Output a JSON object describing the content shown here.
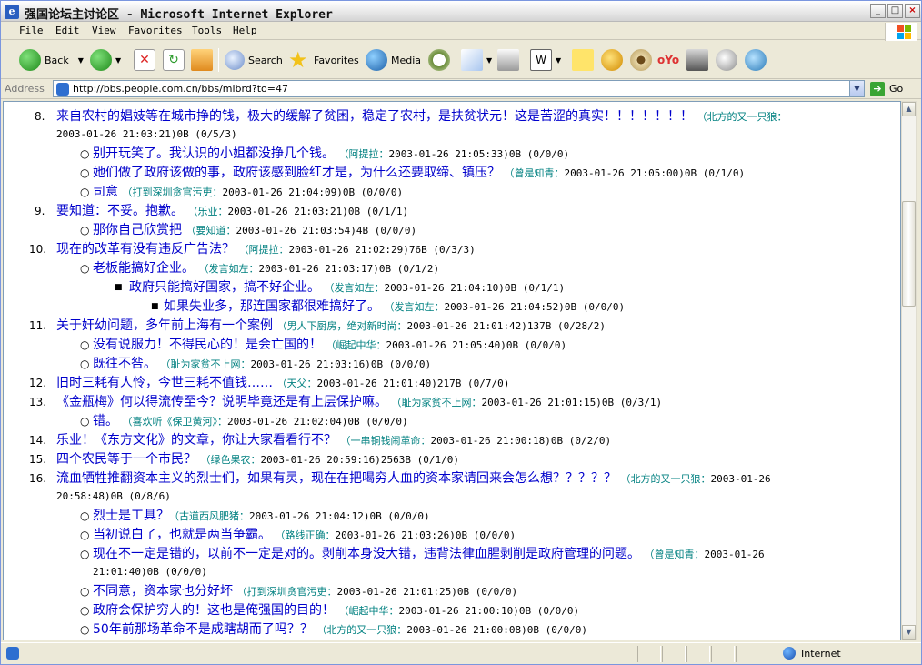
{
  "window": {
    "title": "强国论坛主讨论区 - Microsoft Internet Explorer",
    "minimize": "_",
    "maximize": "□",
    "close": "×"
  },
  "menu": [
    "File",
    "Edit",
    "View",
    "Favorites",
    "Tools",
    "Help"
  ],
  "toolbar": {
    "back": "Back",
    "search": "Search",
    "favorites": "Favorites",
    "media": "Media"
  },
  "address": {
    "label": "Address",
    "url": "http://bbs.people.com.cn/bbs/mlbrd?to=47",
    "go": "Go"
  },
  "status": {
    "zone": "Internet"
  },
  "posts": [
    {
      "num": "8.",
      "title": "来自农村的娼妓等在城市挣的钱，极大的缓解了贫困，稳定了农村，是扶贫状元！这是苦涩的真实！！！！！！！",
      "author": "（北方的又一只狼：",
      "meta": "2003-01-26 21:03:21)0B (0/5/3)"
    },
    {
      "title": "别开玩笑了。我认识的小姐都没挣几个钱。",
      "author": "（阿提拉：",
      "meta": "2003-01-26 21:05:33)0B (0/0/0)"
    },
    {
      "title": "她们做了政府该做的事，政府该感到脸红才是，为什么还要取缔、镇压？",
      "author": "（曾是知青：",
      "meta": "2003-01-26 21:05:00)0B (0/1/0)"
    },
    {
      "title": "司意",
      "author": "（打到深圳贪官污吏：",
      "meta": "2003-01-26 21:04:09)0B (0/0/0)"
    },
    {
      "num": "9.",
      "title": "要知道：不妥。抱歉。",
      "author": "（乐业：",
      "meta": "2003-01-26 21:03:21)0B (0/1/1)"
    },
    {
      "title": "那你自己欣赏把",
      "author": "（要知道：",
      "meta": "2003-01-26 21:03:54)4B (0/0/0)"
    },
    {
      "num": "10.",
      "title": "现在的改革有没有违反广告法？",
      "author": "（阿提拉：",
      "meta": "2003-01-26 21:02:29)76B (0/3/3)"
    },
    {
      "title": "老板能搞好企业。",
      "author": "（发言如左：",
      "meta": "2003-01-26 21:03:17)0B (0/1/2)"
    },
    {
      "title": "政府只能搞好国家，搞不好企业。",
      "author": "（发言如左：",
      "meta": "2003-01-26 21:04:10)0B (0/1/1)"
    },
    {
      "title": "如果失业多，那连国家都很难搞好了。",
      "author": "（发言如左：",
      "meta": "2003-01-26 21:04:52)0B (0/0/0)"
    },
    {
      "num": "11.",
      "title": "关于奸幼问题，多年前上海有一个案例",
      "author": "（男人下厨房，绝对新时尚：",
      "meta": "2003-01-26 21:01:42)137B (0/28/2)"
    },
    {
      "title": "没有说服力！不得民心的！是会亡国的！",
      "author": "（崛起中华：",
      "meta": "2003-01-26 21:05:40)0B (0/0/0)"
    },
    {
      "title": "既往不咎。",
      "author": "（耻为家贫不上网：",
      "meta": "2003-01-26 21:03:16)0B (0/0/0)"
    },
    {
      "num": "12.",
      "title": "旧时三耗有人怜，今世三耗不值钱……",
      "author": "（天父：",
      "meta": "2003-01-26 21:01:40)217B (0/7/0)"
    },
    {
      "num": "13.",
      "title": "《金瓶梅》何以得流传至今？说明毕竟还是有上层保护嘛。",
      "author": "（耻为家贫不上网：",
      "meta": "2003-01-26 21:01:15)0B (0/3/1)"
    },
    {
      "title": "错。",
      "author": "（喜欢听《保卫黄河》：",
      "meta": "2003-01-26 21:02:04)0B (0/0/0)"
    },
    {
      "num": "14.",
      "title": "乐业！《东方文化》的文章，你让大家看看行不？",
      "author": "（一串铜钱闹革命：",
      "meta": "2003-01-26 21:00:18)0B (0/2/0)"
    },
    {
      "num": "15.",
      "title": "四个农民等于一个市民？",
      "author": "（绿色果农：",
      "meta": "2003-01-26 20:59:16)2563B (0/1/0)"
    },
    {
      "num": "16.",
      "title": "流血牺牲推翻资本主义的烈士们，如果有灵，现在在把喝穷人血的资本家请回来会怎么想？？？？？",
      "author": "（北方的又一只狼：",
      "meta": "2003-01-26",
      "meta2": "20:58:48)0B (0/8/6)"
    },
    {
      "title": "烈士是工具？",
      "author": "（古道西风肥猪：",
      "meta": "2003-01-26 21:04:12)0B (0/0/0)"
    },
    {
      "title": "当初说白了，也就是两当争霸。",
      "author": "（路线正确：",
      "meta": "2003-01-26 21:03:26)0B (0/0/0)"
    },
    {
      "title": "现在不一定是错的，以前不一定是对的。剥削本身没大错，违背法律血腥剥削是政府管理的问题。",
      "author": "（曾是知青：",
      "meta": "2003-01-26",
      "meta2": "21:01:40)0B (0/0/0)"
    },
    {
      "title": "不同意，资本家也分好坏",
      "author": "（打到深圳贪官污吏：",
      "meta": "2003-01-26 21:01:25)0B (0/0/0)"
    },
    {
      "title": "政府会保护穷人的！这也是俺强国的目的！",
      "author": "（崛起中华：",
      "meta": "2003-01-26 21:00:10)0B (0/0/0)"
    },
    {
      "title": "50年前那场革命不是成瞎胡而了吗？？",
      "author": "（北方的又一只狼：",
      "meta": "2003-01-26 21:00:08)0B (0/0/0)"
    }
  ]
}
